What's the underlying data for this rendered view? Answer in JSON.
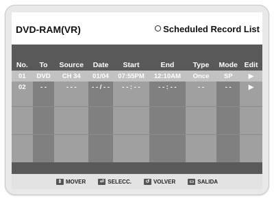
{
  "header": {
    "disc": "DVD-RAM(VR)",
    "title": "Scheduled Record List"
  },
  "columns": [
    "No.",
    "To",
    "Source",
    "Date",
    "Start",
    "End",
    "Type",
    "Mode",
    "Edit"
  ],
  "rows": [
    {
      "no": "01",
      "to": "DVD",
      "source": "CH 34",
      "date": "01/04",
      "start": "07:55PM",
      "end": "12:10AM",
      "type": "Once",
      "mode": "SP",
      "edit": "▶"
    },
    {
      "no": "02",
      "to": "- -",
      "source": "- - -",
      "date": "- - / - -",
      "start": "- - : - -",
      "end": "- - : - -",
      "type": "- -",
      "mode": "- -",
      "edit": "▶"
    }
  ],
  "footer": [
    {
      "icon": "move-icon",
      "glyph": "⇕",
      "label": "MOVER"
    },
    {
      "icon": "select-icon",
      "glyph": "⏎",
      "label": "SELECC."
    },
    {
      "icon": "return-icon",
      "glyph": "↺",
      "label": "VOLVER"
    },
    {
      "icon": "exit-icon",
      "glyph": "▭",
      "label": "SALIDA"
    }
  ]
}
